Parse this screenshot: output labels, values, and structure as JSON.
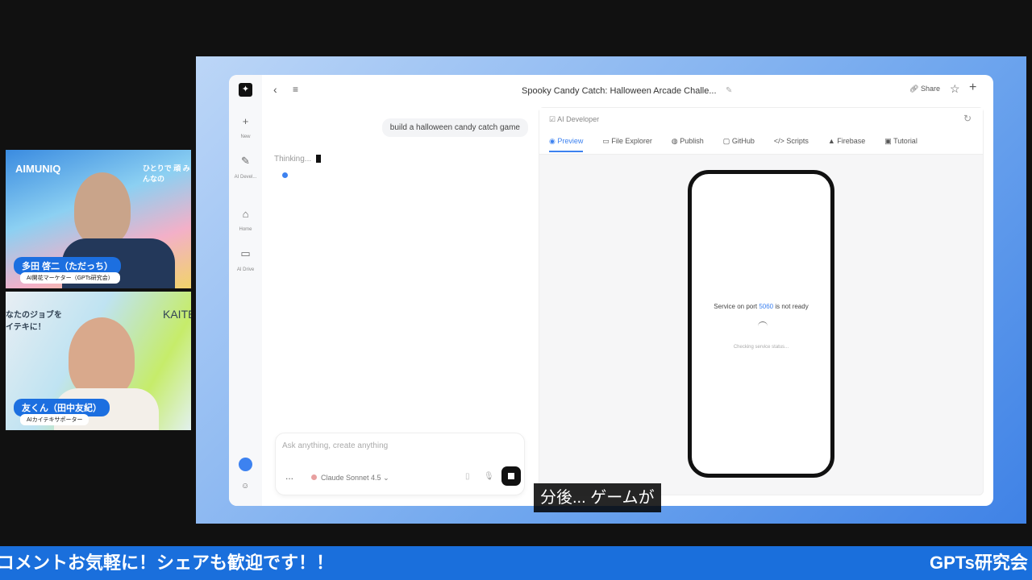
{
  "app": {
    "title": "Spooky Candy Catch: Halloween Arcade Challe...",
    "share": "Share"
  },
  "sidebar": {
    "items": [
      {
        "label": "New"
      },
      {
        "label": "AI Devel..."
      },
      {
        "label": "Home"
      },
      {
        "label": "AI Drive"
      }
    ]
  },
  "chat": {
    "user_message": "build a halloween candy catch game",
    "status": "Thinking...",
    "input_placeholder": "Ask anything, create anything",
    "model": "Claude Sonnet 4.5",
    "more": "..."
  },
  "panel": {
    "header": "AI Developer",
    "tabs": [
      {
        "label": "Preview"
      },
      {
        "label": "File Explorer"
      },
      {
        "label": "Publish"
      },
      {
        "label": "GitHub"
      },
      {
        "label": "Scripts"
      },
      {
        "label": "Firebase"
      },
      {
        "label": "Tutorial"
      }
    ],
    "preview": {
      "msg_pre": "Service on port ",
      "port": "5060",
      "msg_post": " is not ready",
      "checking": "Checking service status..."
    }
  },
  "cams": [
    {
      "name": "多田 啓二（ただっち）",
      "role": "AI開花マーケター（GPTs研究会）",
      "bg_brand": "AIMUNIQ",
      "bg_text": "ひとりで 頑 みんなの"
    },
    {
      "name": "友くん（田中友紀）",
      "role": "AIカイテキサポーター",
      "bg_brand": "KAITE",
      "bg_text": "なたのジョブを イテキに！"
    }
  ],
  "banner": {
    "left": "コメントお気軽に！シェアも歓迎です！！",
    "right": "GPTs研究会"
  },
  "subtitle": "分後... ゲームが",
  "colors": {
    "accent": "#3d82f0",
    "banner": "#1a6fdc"
  }
}
